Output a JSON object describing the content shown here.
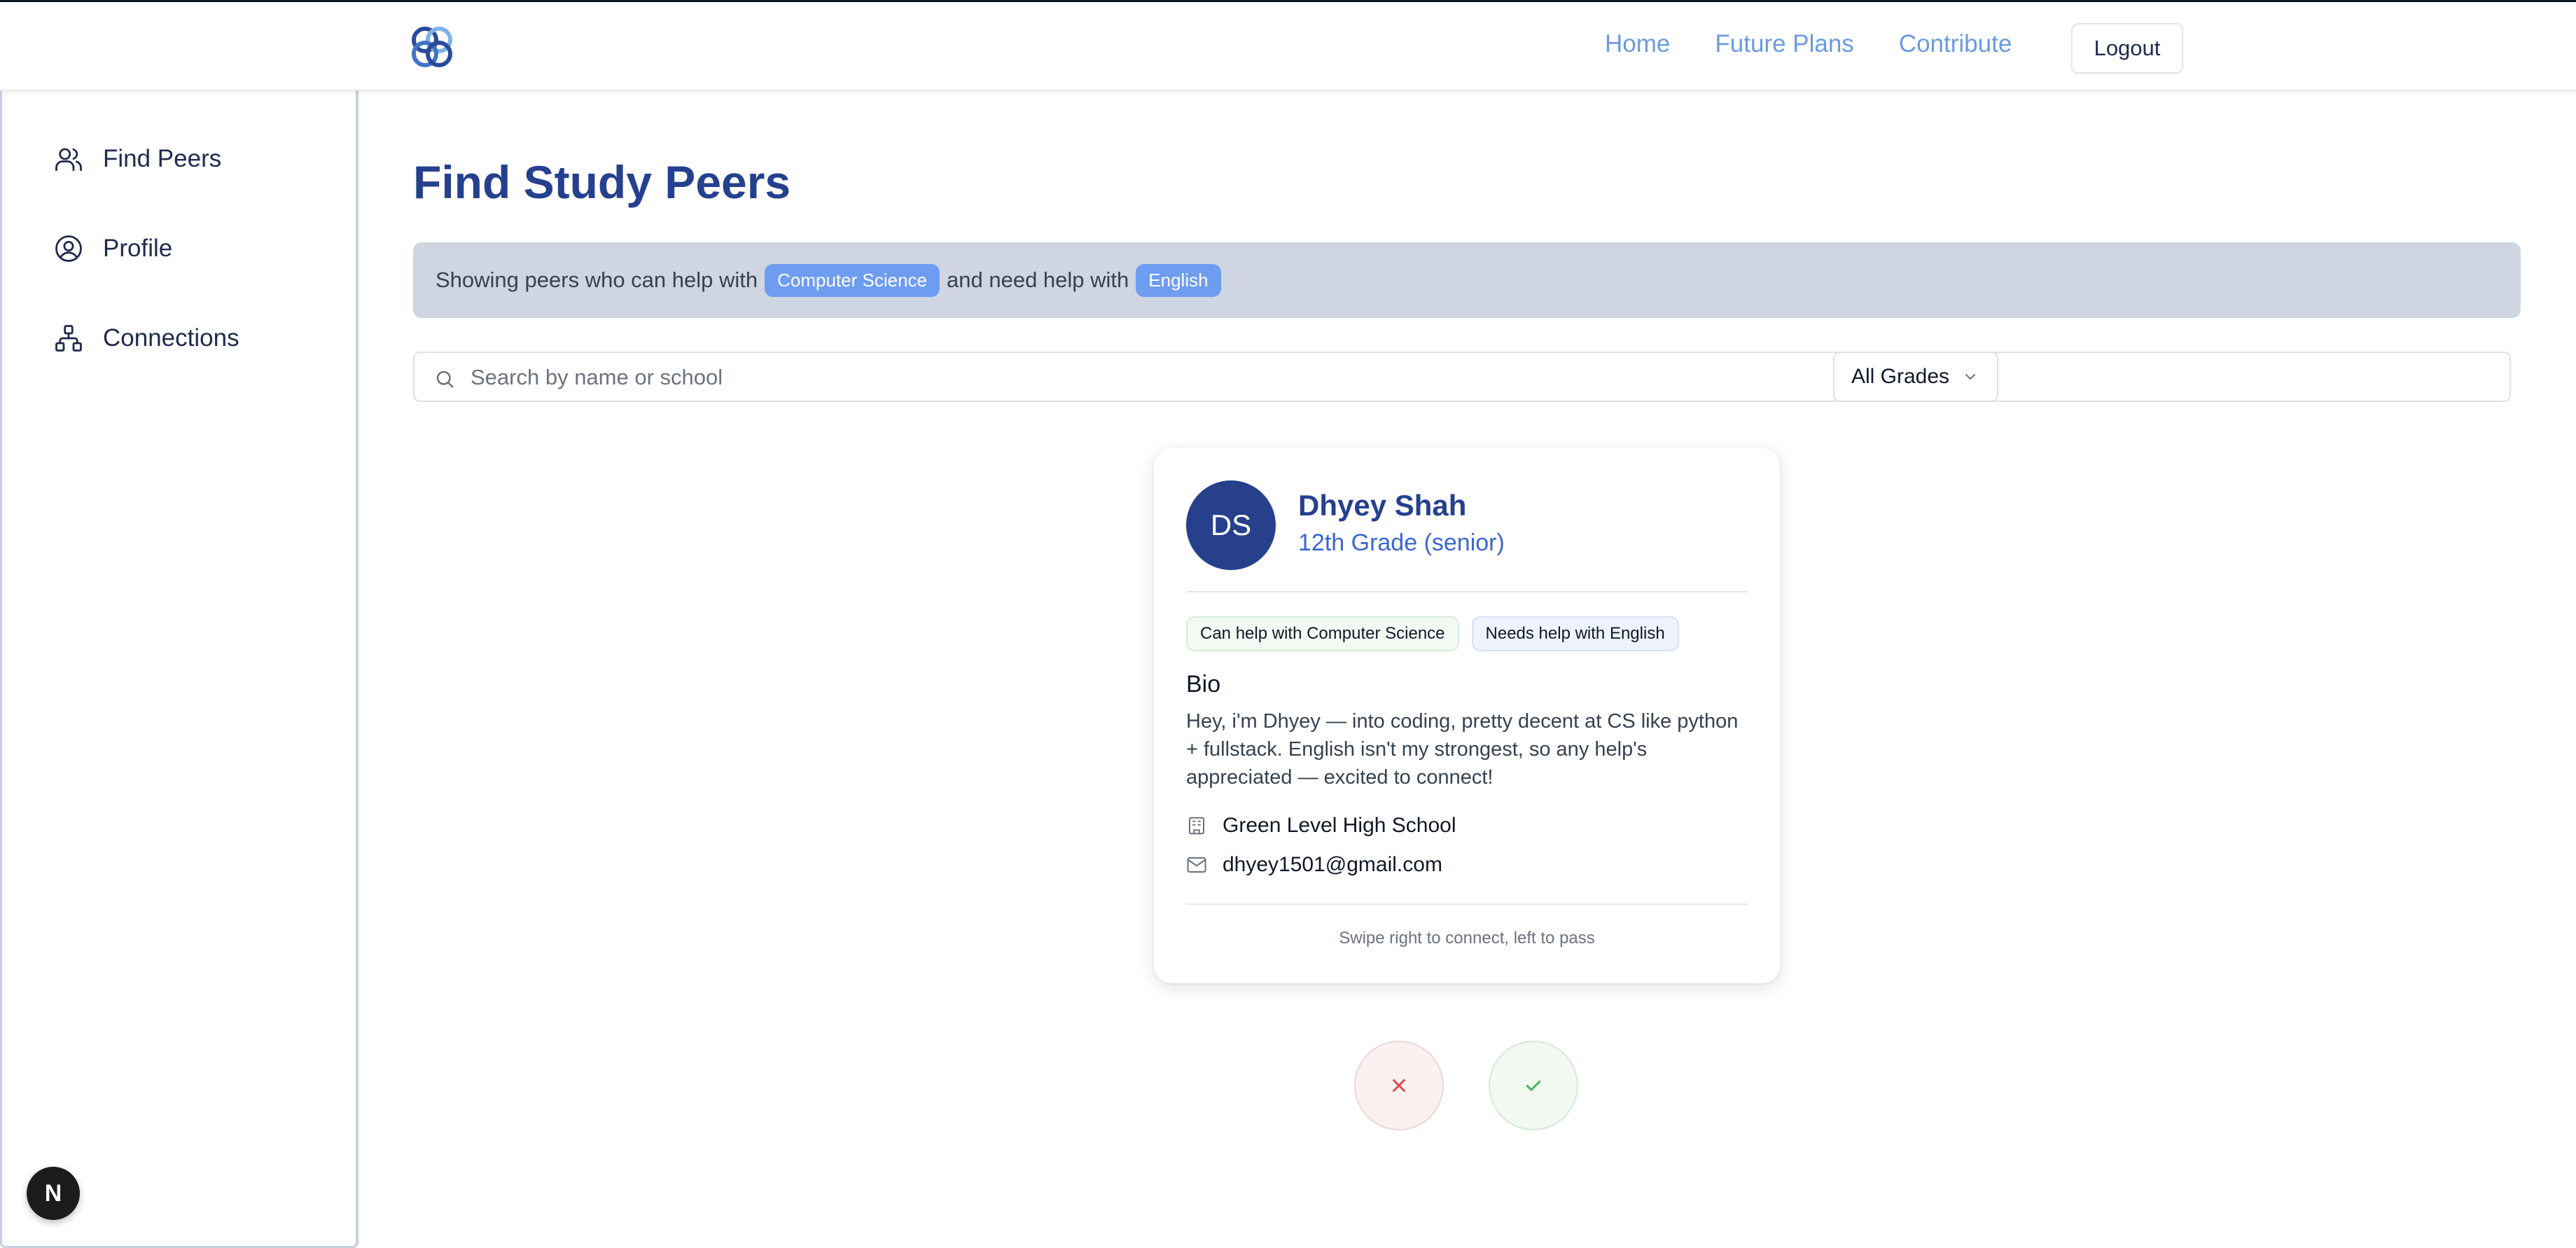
{
  "nav": {
    "links": [
      "Home",
      "Future Plans",
      "Contribute"
    ],
    "logout_label": "Logout"
  },
  "sidebar": {
    "items": [
      {
        "label": "Find Peers",
        "icon": "users-icon"
      },
      {
        "label": "Profile",
        "icon": "user-circle-icon"
      },
      {
        "label": "Connections",
        "icon": "network-icon"
      }
    ],
    "badge": "N"
  },
  "main": {
    "title": "Find Study Peers",
    "banner": {
      "text_before": "Showing peers who can help with",
      "help_subject": "Computer Science",
      "text_middle": "and need help with",
      "need_subject": "English"
    },
    "search": {
      "placeholder": "Search by name or school",
      "value": ""
    },
    "grade_filter": {
      "selected": "All Grades"
    }
  },
  "card": {
    "initials": "DS",
    "name": "Dhyey Shah",
    "grade": "12th Grade (senior)",
    "tags": [
      "Can help with Computer Science",
      "Needs help with English"
    ],
    "bio_heading": "Bio",
    "bio": "Hey, i'm Dhyey — into coding, pretty decent at CS like python + fullstack. English isn't my strongest, so any help's appreciated — excited to connect!",
    "school": "Green Level High School",
    "email": "dhyey1501@gmail.com",
    "hint": "Swipe right to connect, left to pass"
  },
  "colors": {
    "brand": "#25408f",
    "nav_link": "#6b9ae0",
    "pill": "#6e9cf0",
    "banner_bg": "#cfd5e1",
    "reject": "#e04848",
    "accept": "#4caf60"
  }
}
